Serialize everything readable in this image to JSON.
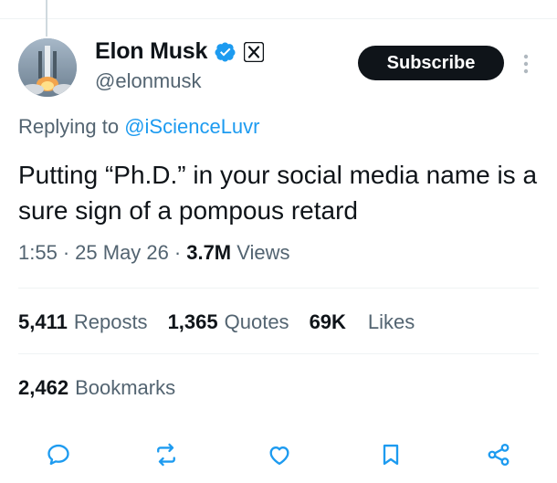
{
  "tweet": {
    "author": {
      "name": "Elon Musk",
      "handle": "@elonmusk",
      "avatar_icon": "rocket-launch-avatar"
    },
    "subscribe_label": "Subscribe",
    "replying_prefix": "Replying to",
    "replying_to": "@iScienceLuvr",
    "text": "Putting “Ph.D.” in your social media name is a sure sign of a pompous retard",
    "time": "1:55",
    "date": "25 May 26",
    "views_count": "3.7M",
    "views_label": "Views",
    "separator": "·",
    "stats": {
      "reposts_count": "5,411",
      "reposts_label": "Reposts",
      "quotes_count": "1,365",
      "quotes_label": "Quotes",
      "likes_count": "69K",
      "likes_label": "Likes",
      "bookmarks_count": "2,462",
      "bookmarks_label": "Bookmarks"
    }
  },
  "actions": [
    "reply-icon",
    "repost-icon",
    "like-icon",
    "bookmark-icon",
    "share-icon"
  ],
  "colors": {
    "text": "#0f1419",
    "secondary": "#536471",
    "link": "#1d9bf0",
    "verified": "#1d9bf0",
    "action_icon": "#1d9bf0",
    "divider": "#eff3f4"
  }
}
